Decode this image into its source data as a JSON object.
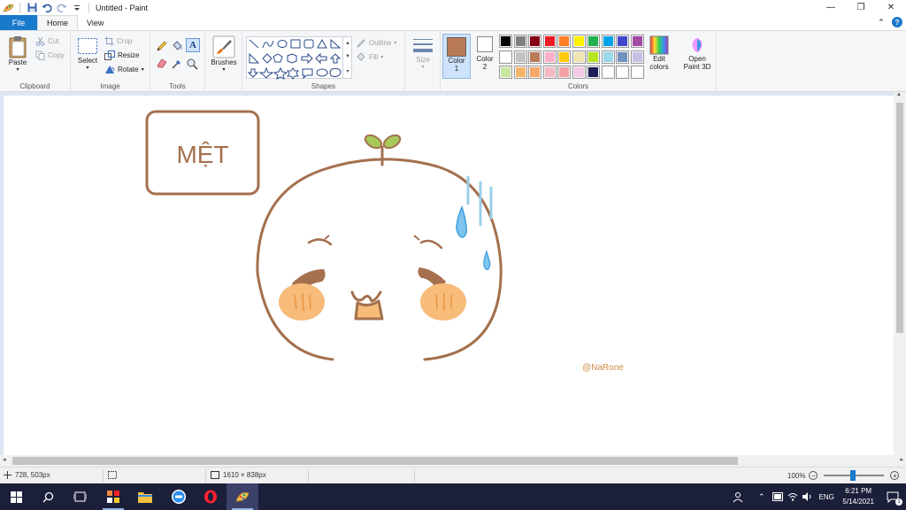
{
  "window": {
    "title": "Untitled - Paint",
    "controls": {
      "minimize": "—",
      "maximize": "❐",
      "close": "✕"
    }
  },
  "tabs": [
    {
      "label": "File"
    },
    {
      "label": "Home"
    },
    {
      "label": "View"
    }
  ],
  "ribbon": {
    "clipboard": {
      "label": "Clipboard",
      "paste": "Paste",
      "cut": "Cut",
      "copy": "Copy"
    },
    "image": {
      "label": "Image",
      "select": "Select",
      "crop": "Crop",
      "resize": "Resize",
      "rotate": "Rotate"
    },
    "tools": {
      "label": "Tools"
    },
    "brushes": {
      "label": "Brushes"
    },
    "shapes": {
      "label": "Shapes",
      "outline": "Outline",
      "fill": "Fill"
    },
    "size": {
      "label": "Size"
    },
    "colors": {
      "label": "Colors",
      "color1_label": "Color",
      "color1_num": "1",
      "color2_label": "Color",
      "color2_num": "2",
      "color1_value": "#b97a57",
      "color2_value": "#ffffff",
      "edit_label": "Edit",
      "edit_label2": "colors",
      "palette_row1": [
        "#000000",
        "#7f7f7f",
        "#880015",
        "#ed1c24",
        "#ff7f27",
        "#fff200",
        "#22b14c",
        "#00a2e8",
        "#3f48cc",
        "#a349a4"
      ],
      "palette_row2": [
        "#ffffff",
        "#c3c3c3",
        "#b97a57",
        "#ffaec9",
        "#ffc90e",
        "#efe4b0",
        "#b5e61d",
        "#99d9ea",
        "#7092be",
        "#c8bfe7"
      ],
      "palette_row3": [
        "#c8e8a0",
        "#f5b56a",
        "#f5a86a",
        "#f7b9c4",
        "#f2a2a6",
        "#f4c9e6",
        "#1e1e5a",
        "#ffffff",
        "#ffffff",
        "#ffffff"
      ]
    },
    "paint3d": {
      "label": "Open",
      "label2": "Paint 3D"
    }
  },
  "canvas": {
    "speech_text": "MỆT",
    "signature": "@NaRone",
    "stroke_color": "#a4704e",
    "cheek_color": "#f7bb7a",
    "drop_color": "#3e9fe0",
    "sprout_color": "#a7c85a"
  },
  "status": {
    "cursor_pos": "728, 503px",
    "canvas_size": "1610 × 838px",
    "zoom": "100%"
  },
  "taskbar": {
    "lang": "ENG",
    "time": "6:21 PM",
    "date": "5/14/2021",
    "notification_count": "1"
  }
}
